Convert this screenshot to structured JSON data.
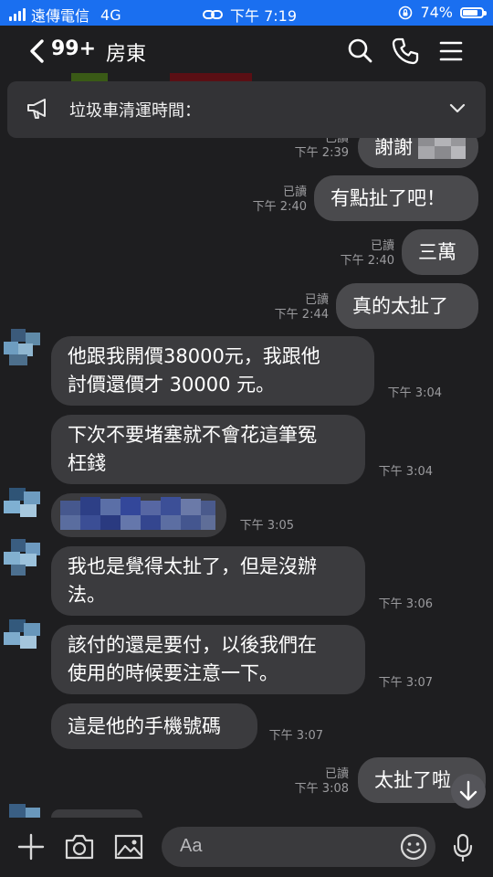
{
  "status_bar": {
    "carrier": "遠傳電信",
    "network": "4G",
    "time": "下午 7:19",
    "battery": "74%",
    "battery_level": 0.74
  },
  "header": {
    "unread_count": "99+",
    "title": "房東"
  },
  "announcement": {
    "text": "垃圾車清運時間："
  },
  "messages": [
    {
      "dir": "out",
      "text": "謝謝",
      "read": "已讀",
      "time": "下午 2:39"
    },
    {
      "dir": "out",
      "text": "有點扯了吧！",
      "read": "已讀",
      "time": "下午 2:40"
    },
    {
      "dir": "out",
      "text": "三萬",
      "read": "已讀",
      "time": "下午 2:40"
    },
    {
      "dir": "out",
      "text": "真的太扯了",
      "read": "已讀",
      "time": "下午 2:44"
    },
    {
      "dir": "in",
      "lines": [
        "他跟我開價38000元，我跟他",
        "討價還價才 30000 元。"
      ],
      "time": "下午 3:04"
    },
    {
      "dir": "in",
      "lines": [
        "下次不要堵塞就不會花這筆冤",
        "枉錢"
      ],
      "time": "下午 3:04"
    },
    {
      "dir": "in",
      "time": "下午 3:05"
    },
    {
      "dir": "in",
      "lines": [
        "我也是覺得太扯了，但是沒辦",
        "法。"
      ],
      "time": "下午 3:06"
    },
    {
      "dir": "in",
      "lines": [
        "該付的還是要付，以後我們在",
        "使用的時候要注意一下。"
      ],
      "time": "下午 3:07"
    },
    {
      "dir": "in",
      "text": "這是他的手機號碼",
      "time": "下午 3:07"
    },
    {
      "dir": "out",
      "text": "太扯了啦",
      "read": "已讀",
      "time": "下午 3:08"
    }
  ],
  "input": {
    "placeholder": "Aa"
  },
  "colors": {
    "status_bar": "#1a6ff0",
    "background": "#1e1e20",
    "bubble_in": "#3b3b3e",
    "bubble_out": "#4a4a4d",
    "banner": "#333336",
    "meta_text": "#9c9c9f"
  }
}
